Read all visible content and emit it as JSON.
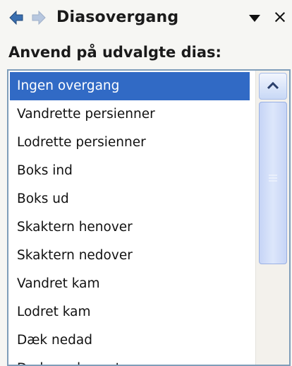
{
  "pane": {
    "title": "Diasovergang",
    "close_glyph": "×",
    "icons": [
      "back-arrow-icon",
      "forward-arrow-icon",
      "dropdown-triangle-icon",
      "close-icon"
    ]
  },
  "section": {
    "label": "Anvend på udvalgte dias:"
  },
  "transitions": {
    "selected_index": 0,
    "items": [
      "Ingen overgang",
      "Vandrette persienner",
      "Lodrette persienner",
      "Boks ind",
      "Boks ud",
      "Skaktern henover",
      "Skaktern nedover",
      "Vandret kam",
      "Lodret kam",
      "Dæk nedad",
      "Dæk mod venstre"
    ]
  },
  "colors": {
    "selection": "#316ac5",
    "list_border": "#7f9db9",
    "nav_arrow": "#3a7d3a"
  }
}
